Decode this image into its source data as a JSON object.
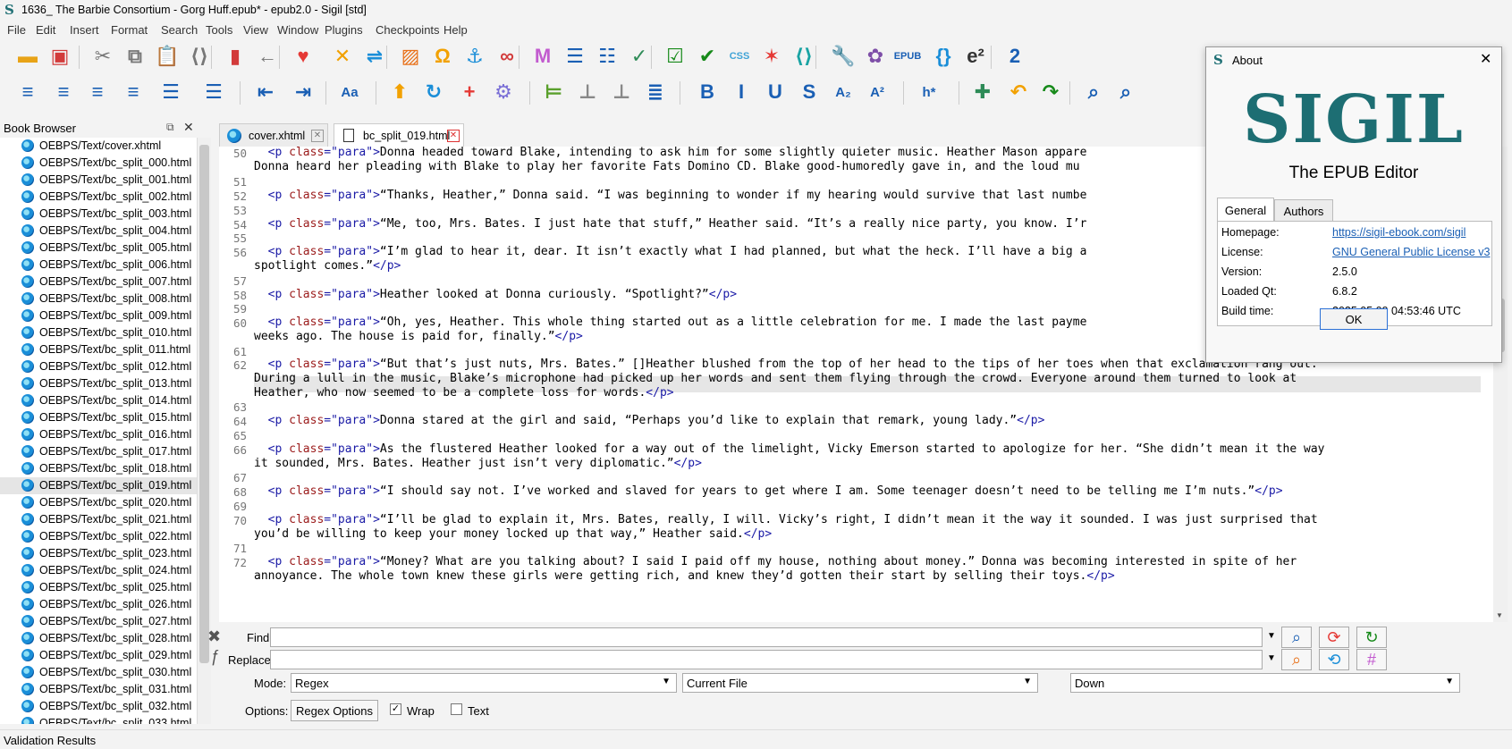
{
  "window": {
    "title": "1636_ The Barbie Consortium - Gorg Huff.epub* - epub2.0 - Sigil [std]",
    "logo": "S"
  },
  "menu": [
    "File",
    "Edit",
    "Insert",
    "Format",
    "Search",
    "Tools",
    "View",
    "Window",
    "Plugins",
    "Checkpoints",
    "Help"
  ],
  "toolbar1": [
    {
      "name": "open-icon",
      "glyph": "▬",
      "color": "#e8a317"
    },
    {
      "name": "save-icon",
      "glyph": "▣",
      "color": "#d23b3b"
    },
    {
      "name": "cut-icon",
      "glyph": "✂",
      "color": "#777"
    },
    {
      "name": "copy-icon",
      "glyph": "⧉",
      "color": "#777"
    },
    {
      "name": "paste-icon",
      "glyph": "📋",
      "color": "#777"
    },
    {
      "name": "code-icon",
      "glyph": "⟨⟩",
      "color": "#777"
    },
    {
      "name": "bookmark-icon",
      "glyph": "▮",
      "color": "#d23b3b"
    },
    {
      "name": "back-icon",
      "glyph": "←",
      "color": "#777"
    },
    {
      "name": "heart-icon",
      "glyph": "♥",
      "color": "#e53935"
    },
    {
      "name": "split-icon",
      "glyph": "✕",
      "color": "#f2a100"
    },
    {
      "name": "merge-icon",
      "glyph": "⇌",
      "color": "#1a8ed8"
    },
    {
      "name": "image-icon",
      "glyph": "▨",
      "color": "#e8711a"
    },
    {
      "name": "omega-icon",
      "glyph": "Ω",
      "color": "#f2a100"
    },
    {
      "name": "anchor-icon",
      "glyph": "⚓",
      "color": "#1a8ed8"
    },
    {
      "name": "link-icon",
      "glyph": "∞",
      "color": "#d23b3b"
    },
    {
      "name": "meta-icon",
      "glyph": "M",
      "color": "#c25bcf"
    },
    {
      "name": "toc-icon",
      "glyph": "☰",
      "color": "#1a5fb4"
    },
    {
      "name": "report-icon",
      "glyph": "☷",
      "color": "#1a5fb4"
    },
    {
      "name": "spellcheck-icon",
      "glyph": "✓",
      "color": "#2e8b57"
    },
    {
      "name": "validate-icon",
      "glyph": "☑",
      "color": "#178a1a"
    },
    {
      "name": "well-formed-icon",
      "glyph": "✔",
      "color": "#178a1a"
    },
    {
      "name": "css-icon",
      "glyph": "CSS",
      "color": "#3fa3d6"
    },
    {
      "name": "sparkle-icon",
      "glyph": "✶",
      "color": "#e53935"
    },
    {
      "name": "html-icon",
      "glyph": "⟨⟩",
      "color": "#1aa3a3"
    },
    {
      "name": "wrench-icon",
      "glyph": "🔧",
      "color": "#1a5fb4"
    },
    {
      "name": "plugin-icon",
      "glyph": "✿",
      "color": "#7e4fa8"
    },
    {
      "name": "epubclean-icon",
      "glyph": "EPUB",
      "color": "#1a5fb4"
    },
    {
      "name": "css-tool-icon",
      "glyph": "{}",
      "color": "#1a8ed8"
    },
    {
      "name": "e2e-icon",
      "glyph": "e²",
      "color": "#333"
    },
    {
      "name": "number-icon",
      "glyph": "2",
      "color": "#1a5fb4"
    }
  ],
  "toolbar2": [
    {
      "name": "align-left-icon",
      "glyph": "≡",
      "color": "#1a5fb4"
    },
    {
      "name": "align-center-icon",
      "glyph": "≡",
      "color": "#1a5fb4"
    },
    {
      "name": "align-right-icon",
      "glyph": "≡",
      "color": "#1a5fb4"
    },
    {
      "name": "justify-icon",
      "glyph": "≡",
      "color": "#1a5fb4"
    },
    {
      "name": "bullet-list-icon",
      "glyph": "☰",
      "color": "#1a5fb4"
    },
    {
      "name": "numbered-list-icon",
      "glyph": "☰",
      "color": "#1a5fb4"
    },
    {
      "name": "outdent-icon",
      "glyph": "⇤",
      "color": "#1a5fb4"
    },
    {
      "name": "indent-icon",
      "glyph": "⇥",
      "color": "#1a5fb4"
    },
    {
      "name": "case-icon",
      "glyph": "Aa",
      "color": "#1a5fb4"
    },
    {
      "name": "up-icon",
      "glyph": "⬆",
      "color": "#f2a100"
    },
    {
      "name": "refresh-icon",
      "glyph": "↻",
      "color": "#1a8ed8"
    },
    {
      "name": "add-icon",
      "glyph": "+",
      "color": "#e53935"
    },
    {
      "name": "settings-icon",
      "glyph": "⚙",
      "color": "#7a6fd6"
    },
    {
      "name": "insert-row-icon",
      "glyph": "⊨",
      "color": "#5aa02c"
    },
    {
      "name": "move-icon",
      "glyph": "⊥",
      "color": "#888"
    },
    {
      "name": "delete-row-icon",
      "glyph": "⊥",
      "color": "#888"
    },
    {
      "name": "list-icon",
      "glyph": "≣",
      "color": "#1a5fb4"
    },
    {
      "name": "bold-icon",
      "glyph": "B",
      "color": "#1a5fb4"
    },
    {
      "name": "italic-icon",
      "glyph": "I",
      "color": "#1a5fb4"
    },
    {
      "name": "underline-icon",
      "glyph": "U",
      "color": "#1a5fb4"
    },
    {
      "name": "strike-icon",
      "glyph": "S",
      "color": "#1a5fb4"
    },
    {
      "name": "subscript-icon",
      "glyph": "A₂",
      "color": "#1a5fb4"
    },
    {
      "name": "superscript-icon",
      "glyph": "A²",
      "color": "#1a5fb4"
    },
    {
      "name": "heading-icon",
      "glyph": "h*",
      "color": "#1a5fb4"
    },
    {
      "name": "add-circle-icon",
      "glyph": "✚",
      "color": "#2e8b57"
    },
    {
      "name": "undo-icon",
      "glyph": "↶",
      "color": "#f2a100"
    },
    {
      "name": "redo-icon",
      "glyph": "↷",
      "color": "#178a1a"
    },
    {
      "name": "search-icon",
      "glyph": "⌕",
      "color": "#1a5fb4"
    },
    {
      "name": "search-settings-icon",
      "glyph": "⌕",
      "color": "#1a5fb4"
    }
  ],
  "bookbrowser": {
    "title": "Book Browser",
    "files": [
      "OEBPS/Text/cover.xhtml",
      "OEBPS/Text/bc_split_000.html",
      "OEBPS/Text/bc_split_001.html",
      "OEBPS/Text/bc_split_002.html",
      "OEBPS/Text/bc_split_003.html",
      "OEBPS/Text/bc_split_004.html",
      "OEBPS/Text/bc_split_005.html",
      "OEBPS/Text/bc_split_006.html",
      "OEBPS/Text/bc_split_007.html",
      "OEBPS/Text/bc_split_008.html",
      "OEBPS/Text/bc_split_009.html",
      "OEBPS/Text/bc_split_010.html",
      "OEBPS/Text/bc_split_011.html",
      "OEBPS/Text/bc_split_012.html",
      "OEBPS/Text/bc_split_013.html",
      "OEBPS/Text/bc_split_014.html",
      "OEBPS/Text/bc_split_015.html",
      "OEBPS/Text/bc_split_016.html",
      "OEBPS/Text/bc_split_017.html",
      "OEBPS/Text/bc_split_018.html",
      "OEBPS/Text/bc_split_019.html",
      "OEBPS/Text/bc_split_020.html",
      "OEBPS/Text/bc_split_021.html",
      "OEBPS/Text/bc_split_022.html",
      "OEBPS/Text/bc_split_023.html",
      "OEBPS/Text/bc_split_024.html",
      "OEBPS/Text/bc_split_025.html",
      "OEBPS/Text/bc_split_026.html",
      "OEBPS/Text/bc_split_027.html",
      "OEBPS/Text/bc_split_028.html",
      "OEBPS/Text/bc_split_029.html",
      "OEBPS/Text/bc_split_030.html",
      "OEBPS/Text/bc_split_031.html",
      "OEBPS/Text/bc_split_032.html",
      "OEBPS/Text/bc_split_033.html"
    ],
    "selected": "OEBPS/Text/bc_split_019.html"
  },
  "tabs": [
    {
      "label": "cover.xhtml"
    },
    {
      "label": "bc_split_019.html",
      "active": true
    }
  ],
  "editor": {
    "lines": [
      {
        "n": "50",
        "t": [
          [
            "tag",
            "  <p "
          ],
          [
            "attr",
            "class"
          ],
          [
            "tag",
            "=\"para\">"
          ],
          [
            "",
            "Donna headed toward Blake, intending to ask him for some slightly quieter music. Heather Mason appare"
          ]
        ]
      },
      {
        "n": "",
        "t": [
          [
            "",
            "Donna heard her pleading with Blake to play her favorite Fats Domino CD. Blake good-humoredly gave in, and the loud mu"
          ]
        ]
      },
      {
        "n": "51",
        "t": []
      },
      {
        "n": "52",
        "t": [
          [
            "tag",
            "  <p "
          ],
          [
            "attr",
            "class"
          ],
          [
            "tag",
            "=\"para\">"
          ],
          [
            "",
            "“Thanks, Heather,” Donna said. “I was beginning to wonder if my hearing would survive that last numbe"
          ]
        ]
      },
      {
        "n": "53",
        "t": []
      },
      {
        "n": "54",
        "t": [
          [
            "tag",
            "  <p "
          ],
          [
            "attr",
            "class"
          ],
          [
            "tag",
            "=\"para\">"
          ],
          [
            "",
            "“Me, too, Mrs. Bates. I just hate that stuff,” Heather said. “It’s a really nice party, you know. I’r"
          ]
        ]
      },
      {
        "n": "55",
        "t": []
      },
      {
        "n": "56",
        "t": [
          [
            "tag",
            "  <p "
          ],
          [
            "attr",
            "class"
          ],
          [
            "tag",
            "=\"para\">"
          ],
          [
            "",
            "“I’m glad to hear it, dear. It isn’t exactly what I had planned, but what the heck. I’ll have a big a"
          ]
        ]
      },
      {
        "n": "",
        "t": [
          [
            "",
            "spotlight comes.”"
          ],
          [
            "tag",
            "</p>"
          ]
        ]
      },
      {
        "n": "57",
        "t": []
      },
      {
        "n": "58",
        "t": [
          [
            "tag",
            "  <p "
          ],
          [
            "attr",
            "class"
          ],
          [
            "tag",
            "=\"para\">"
          ],
          [
            "",
            "Heather looked at Donna curiously. “Spotlight?”"
          ],
          [
            "tag",
            "</p>"
          ]
        ]
      },
      {
        "n": "59",
        "t": []
      },
      {
        "n": "60",
        "t": [
          [
            "tag",
            "  <p "
          ],
          [
            "attr",
            "class"
          ],
          [
            "tag",
            "=\"para\">"
          ],
          [
            "",
            "“Oh, yes, Heather. This whole thing started out as a little celebration for me. I made the last payme"
          ]
        ]
      },
      {
        "n": "",
        "t": [
          [
            "",
            "weeks ago. The house is paid for, finally.”"
          ],
          [
            "tag",
            "</p>"
          ]
        ]
      },
      {
        "n": "61",
        "t": []
      },
      {
        "n": "62",
        "t": [
          [
            "tag",
            "  <p "
          ],
          [
            "attr",
            "class"
          ],
          [
            "tag",
            "=\"para\">"
          ],
          [
            "",
            "“But that’s just nuts, Mrs. Bates.” []Heather blushed from the top of her head to the tips of her toes when that exclamation rang out."
          ]
        ]
      },
      {
        "n": "",
        "t": [
          [
            "",
            "During a lull in the music, Blake’s microphone had picked up her words and sent them flying through the crowd. Everyone around them turned to look at"
          ]
        ]
      },
      {
        "n": "",
        "t": [
          [
            "",
            "Heather, who now seemed to be a complete loss for words."
          ],
          [
            "tag",
            "</p>"
          ]
        ]
      },
      {
        "n": "63",
        "t": []
      },
      {
        "n": "64",
        "t": [
          [
            "tag",
            "  <p "
          ],
          [
            "attr",
            "class"
          ],
          [
            "tag",
            "=\"para\">"
          ],
          [
            "",
            "Donna stared at the girl and said, “Perhaps you’d like to explain that remark, young lady.”"
          ],
          [
            "tag",
            "</p>"
          ]
        ]
      },
      {
        "n": "65",
        "t": []
      },
      {
        "n": "66",
        "t": [
          [
            "tag",
            "  <p "
          ],
          [
            "attr",
            "class"
          ],
          [
            "tag",
            "=\"para\">"
          ],
          [
            "",
            "As the flustered Heather looked for a way out of the limelight, Vicky Emerson started to apologize for her. “She didn’t mean it the way"
          ]
        ]
      },
      {
        "n": "",
        "t": [
          [
            "",
            "it sounded, Mrs. Bates. Heather just isn’t very diplomatic.”"
          ],
          [
            "tag",
            "</p>"
          ]
        ]
      },
      {
        "n": "67",
        "t": []
      },
      {
        "n": "68",
        "t": [
          [
            "tag",
            "  <p "
          ],
          [
            "attr",
            "class"
          ],
          [
            "tag",
            "=\"para\">"
          ],
          [
            "",
            "“I should say not. I’ve worked and slaved for years to get where I am. Some teenager doesn’t need to be telling me I’m nuts.”"
          ],
          [
            "tag",
            "</p>"
          ]
        ]
      },
      {
        "n": "69",
        "t": []
      },
      {
        "n": "70",
        "t": [
          [
            "tag",
            "  <p "
          ],
          [
            "attr",
            "class"
          ],
          [
            "tag",
            "=\"para\">"
          ],
          [
            "",
            "“I’ll be glad to explain it, Mrs. Bates, really, I will. Vicky’s right, I didn’t mean it the way it sounded. I was just surprised that"
          ]
        ]
      },
      {
        "n": "",
        "t": [
          [
            "",
            "you’d be willing to keep your money locked up that way,” Heather said."
          ],
          [
            "tag",
            "</p>"
          ]
        ]
      },
      {
        "n": "71",
        "t": []
      },
      {
        "n": "72",
        "t": [
          [
            "tag",
            "  <p "
          ],
          [
            "attr",
            "class"
          ],
          [
            "tag",
            "=\"para\">"
          ],
          [
            "",
            "“Money? What are you talking about? I said I paid off my house, nothing about money.” Donna was becoming interested in spite of her"
          ]
        ]
      },
      {
        "n": "",
        "t": [
          [
            "",
            "annoyance. The whole town knew these girls were getting rich, and knew they’d gotten their start by selling their toys."
          ],
          [
            "tag",
            "</p>"
          ]
        ]
      }
    ]
  },
  "find": {
    "find_label": "Find:",
    "replace_label": "Replace:",
    "mode_label": "Mode:",
    "options_label": "Options:",
    "find_value": "",
    "replace_value": "",
    "mode": "Regex",
    "scope": "Current File",
    "direction": "Down",
    "regex_options": "Regex Options",
    "wrap_label": "Wrap",
    "wrap_checked": true,
    "text_label": "Text",
    "text_checked": false
  },
  "status": {
    "label": "Validation Results"
  },
  "about": {
    "title": "About",
    "logo_text": "SIGIL",
    "subtitle": "The EPUB Editor",
    "tabs": [
      "General",
      "Authors"
    ],
    "rows": [
      {
        "k": "Homepage:",
        "v": "https://sigil-ebook.com/sigil",
        "link": true
      },
      {
        "k": "License:",
        "v": "GNU General Public License v3",
        "link": true
      },
      {
        "k": "Version:",
        "v": "2.5.0"
      },
      {
        "k": "Loaded Qt:",
        "v": "6.8.2"
      },
      {
        "k": "Build time:",
        "v": "2025.05.09 04:53:46 UTC"
      }
    ],
    "ok": "OK"
  }
}
